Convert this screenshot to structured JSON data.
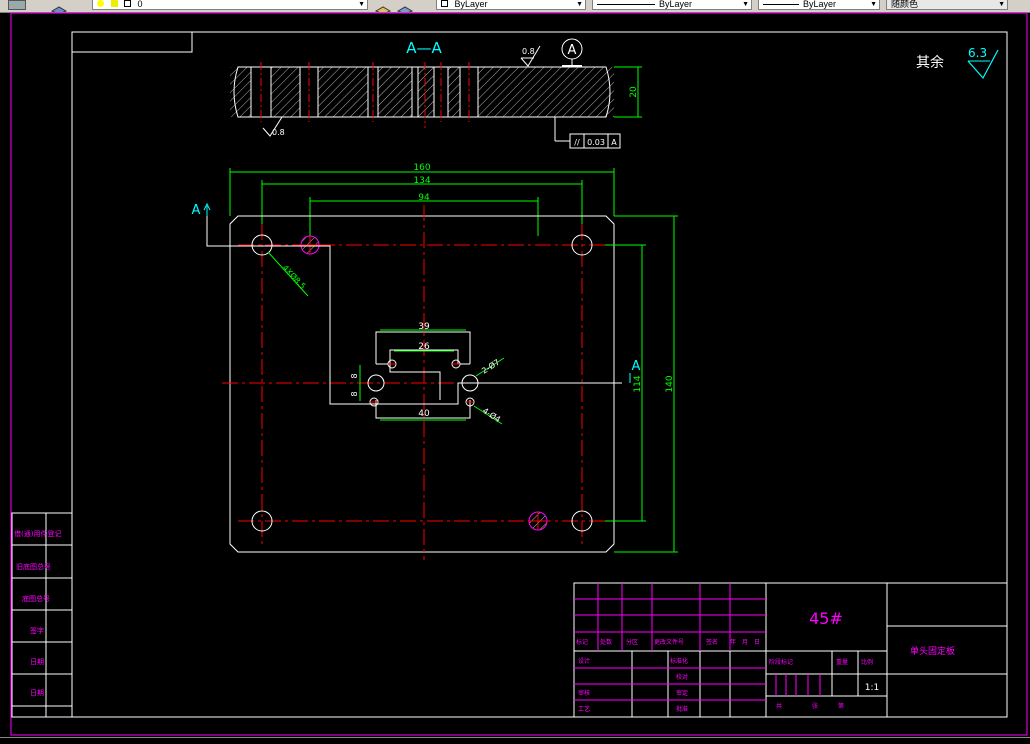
{
  "toolbar": {
    "layer_value": "0",
    "color_value": "ByLayer",
    "linetype_value": "ByLayer",
    "lineweight_value": "ByLayer",
    "plotstyle_value": "随颜色"
  },
  "drawing": {
    "section_label": "A—A",
    "roughness_top": "0.8",
    "datum_label": "A",
    "thickness_dim": "20",
    "roughness_bottom": "0.8",
    "parallel_symbol": "//",
    "parallel_tolerance": "0.03",
    "parallel_datum": "A",
    "remainder_label": "其余",
    "remainder_roughness": "6.3",
    "dim_160": "160",
    "dim_134": "134",
    "dim_94": "94",
    "dim_39": "39",
    "dim_26": "26",
    "dim_40": "40",
    "dim_8a": "8",
    "dim_8b": "8",
    "dim_114": "114",
    "dim_140": "140",
    "hole_callout_1": "4XØ8.5",
    "hole_callout_2": "2-Ø7",
    "hole_callout_3": "4-Ø4",
    "view_arrow_left": "A",
    "view_arrow_right": "A"
  },
  "sidebar": {
    "items": [
      "借(通)用件登记",
      "旧底图总号",
      "底图总号",
      "签字",
      "日期",
      "日期"
    ]
  },
  "title_block": {
    "material": "45#",
    "part_name": "单头固定板",
    "scale": "1:1",
    "row_marks": [
      "标记",
      "处数",
      "分区",
      "更改文件号",
      "签名",
      "年",
      "月",
      "日"
    ],
    "labels": {
      "design": "设计",
      "standardize": "标准化",
      "review": "审核",
      "process": "工艺",
      "check": "校对",
      "audit": "审定",
      "approve": "批准",
      "stage_mark": "阶段标记",
      "weight": "重量",
      "ratio": "比例",
      "sheets_total": "共",
      "sheet": "张",
      "sheet_no": "第"
    }
  },
  "colors": {
    "white": "#ffffff",
    "red": "#ff0000",
    "green": "#00ff00",
    "cyan": "#00ffff",
    "magenta": "#ff00ff"
  }
}
